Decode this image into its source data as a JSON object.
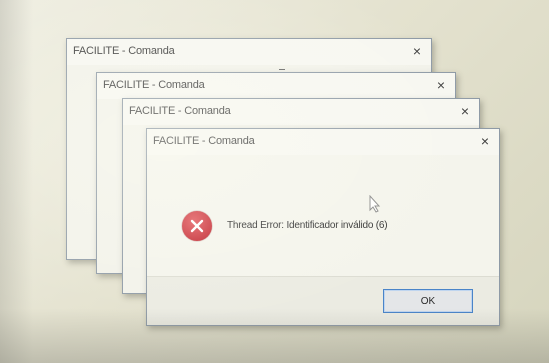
{
  "dialogs": [
    {
      "title": "FACILITE - Comanda",
      "close": "×"
    },
    {
      "title": "FACILITE - Comanda",
      "close": "×"
    },
    {
      "title": "FACILITE - Comanda",
      "close": "×"
    },
    {
      "title": "FACILITE - Comanda",
      "close": "×",
      "message": "Thread Error: Identificador inválido (6)",
      "ok_label": "OK",
      "icon": "error-icon"
    }
  ],
  "colors": {
    "error_red": "#c62a33",
    "button_focus_border": "#4a84c8"
  }
}
